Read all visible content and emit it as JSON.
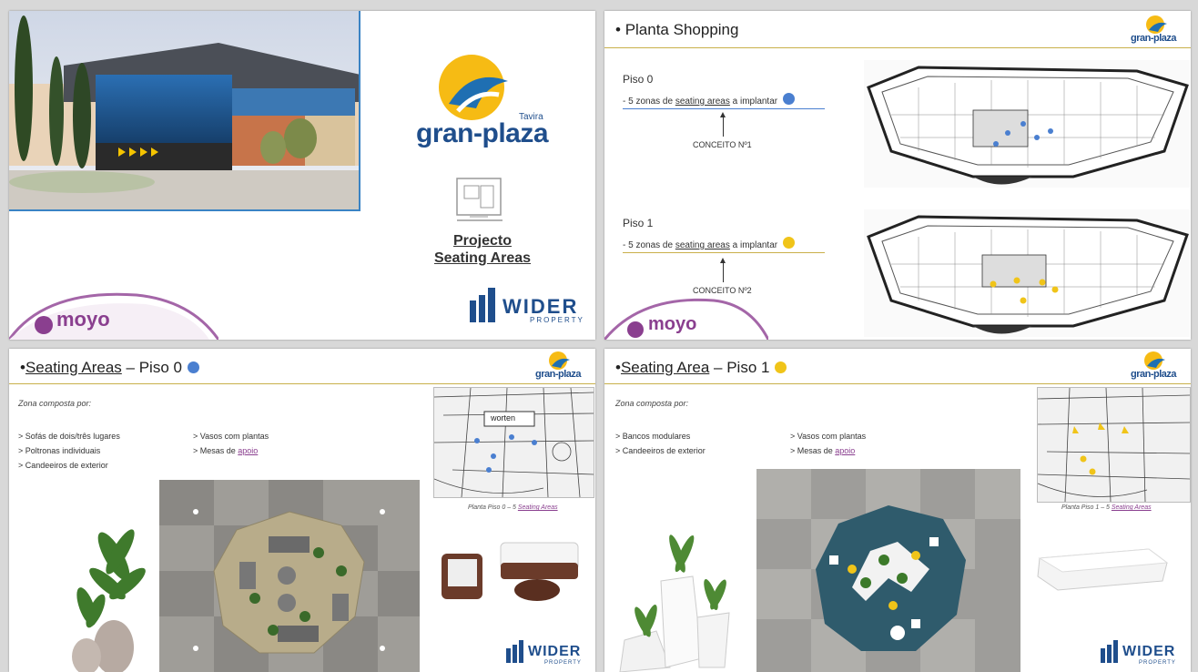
{
  "colors": {
    "blue_dot": "#4a7fd0",
    "yellow_dot": "#f0c419",
    "navy": "#1f4e8c",
    "purple": "#8a3f8f",
    "gold": "#c9b04a"
  },
  "slide1": {
    "brand": {
      "name": "gran-plaza",
      "location": "Tavira"
    },
    "project_title_line1": "Projecto",
    "project_title_line2": "Seating Areas",
    "icon": "blueprint-icon",
    "moyo": "moyo",
    "wider": {
      "name": "WIDER",
      "sub": "PROPERTY"
    }
  },
  "slide2": {
    "title": "Planta Shopping",
    "brand": "gran-plaza",
    "floor0": {
      "label": "Piso 0",
      "desc_prefix": "- 5 zonas de ",
      "desc_link": "seating areas",
      "desc_suffix": " a implantar",
      "concept": "CONCEITO Nº1"
    },
    "floor1": {
      "label": "Piso 1",
      "desc_prefix": "- 5 zonas de ",
      "desc_link": "seating areas",
      "desc_suffix": " a implantar",
      "concept": "CONCEITO Nº2"
    },
    "moyo": "moyo"
  },
  "slide3": {
    "title_prefix": "Seating Areas",
    "title_suffix": " – Piso 0",
    "brand": "gran-plaza",
    "zone_heading": "Zona composta por:",
    "left_items": [
      "> Sofás de dois/três lugares",
      "> Poltronas individuais",
      "> Candeeiros de exterior"
    ],
    "right_items_text": [
      "> Vasos com plantas",
      "> Mesas de "
    ],
    "right_link": "apoio",
    "map_label": "worten",
    "caption_prefix": "Planta Piso 0 – 5 ",
    "caption_link": "Seating Areas",
    "wider": {
      "name": "WIDER",
      "sub": "PROPERTY"
    }
  },
  "slide4": {
    "title_prefix": "Seating Area",
    "title_suffix": " – Piso 1",
    "brand": "gran-plaza",
    "zone_heading": "Zona composta por:",
    "left_items": [
      "> Bancos modulares",
      "> Candeeiros de exterior"
    ],
    "right_items_text": [
      "> Vasos com plantas",
      "> Mesas de "
    ],
    "right_link": "apoio",
    "caption_prefix": "Planta Piso 1 – 5 ",
    "caption_link": "Seating Areas",
    "wider": {
      "name": "WIDER",
      "sub": "PROPERTY"
    }
  }
}
